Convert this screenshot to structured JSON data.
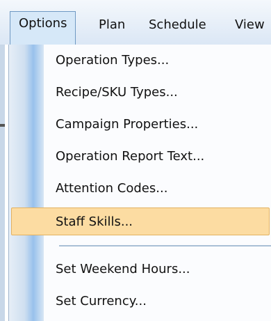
{
  "menubar": {
    "items": [
      {
        "label": "Options",
        "active": true
      },
      {
        "label": "Plan",
        "active": false
      },
      {
        "label": "Schedule",
        "active": false
      },
      {
        "label": "View",
        "active": false
      }
    ]
  },
  "dropdown": {
    "items": [
      {
        "label": "Operation Types..."
      },
      {
        "label": "Recipe/SKU Types..."
      },
      {
        "label": "Campaign Properties..."
      },
      {
        "label": "Operation Report Text..."
      },
      {
        "label": "Attention Codes..."
      },
      {
        "label": "Staff Skills...",
        "highlighted": true
      },
      {
        "label": "Set Weekend Hours..."
      },
      {
        "label": "Set Currency..."
      }
    ]
  },
  "colors": {
    "highlight_fill": "#fcdca2",
    "highlight_border": "#e3b15f",
    "active_menu_fill": "#d6e8f8",
    "gutter_accent": "#98c1ec"
  }
}
